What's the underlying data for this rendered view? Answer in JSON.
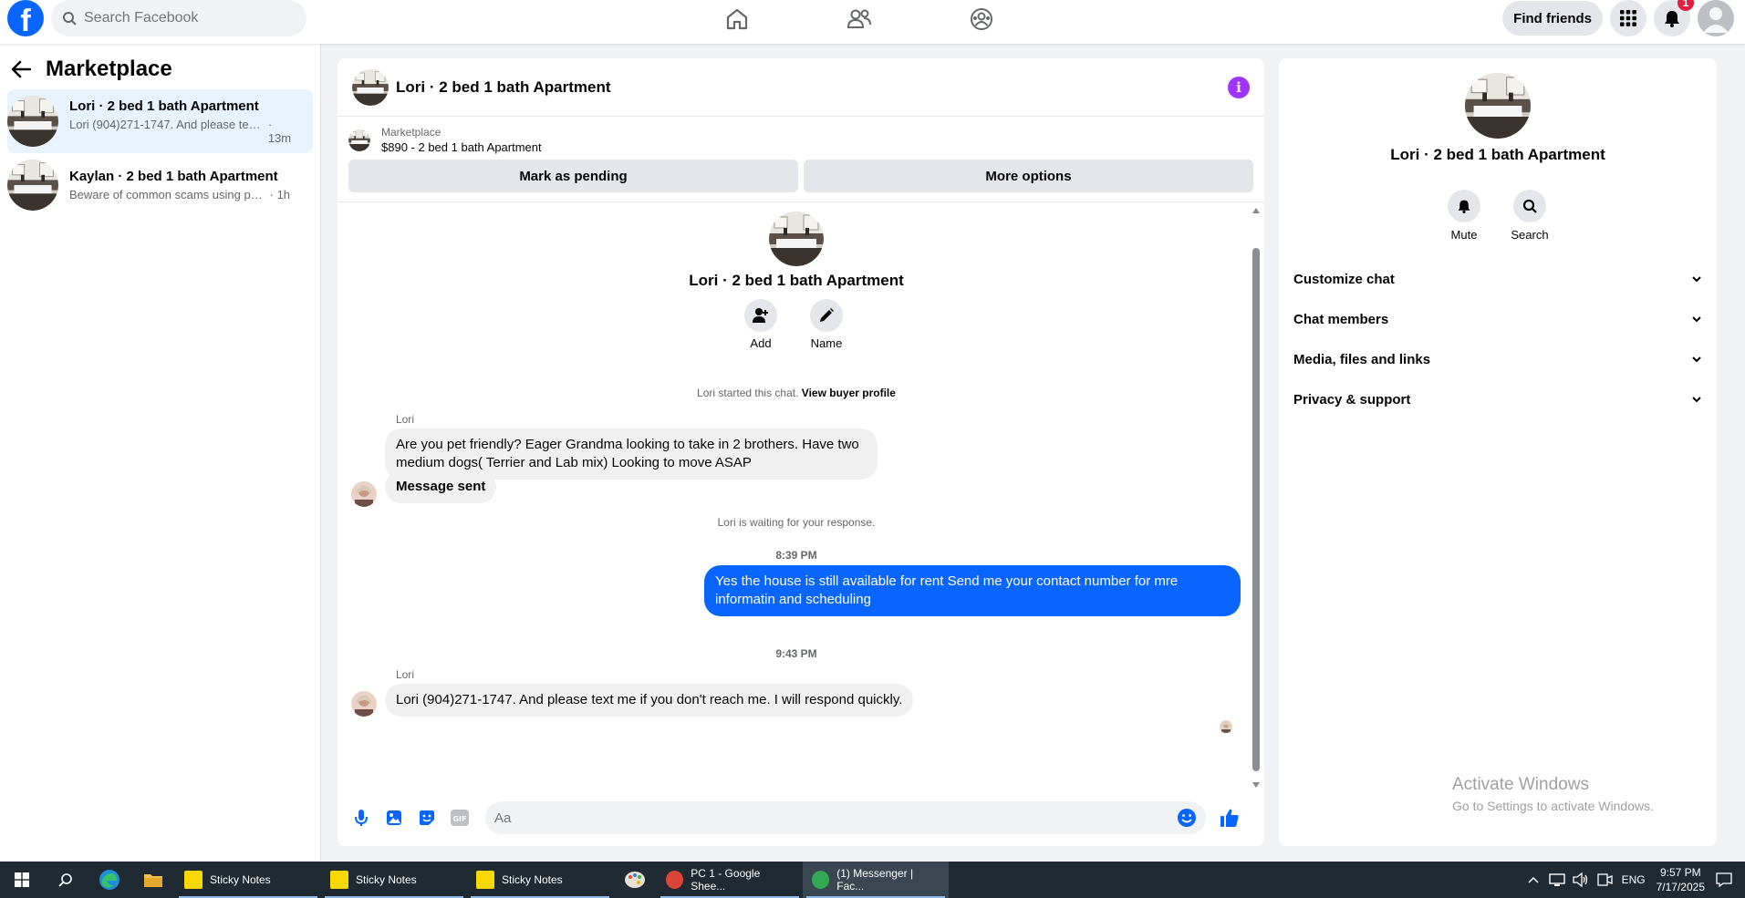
{
  "topbar": {
    "logo": "f",
    "search_placeholder": "Search Facebook",
    "find_friends": "Find friends",
    "notification_count": "1"
  },
  "sidebar": {
    "title": "Marketplace",
    "conversations": [
      {
        "title": "Lori · 2 bed 1 bath Apartment",
        "snippet": "Lori (904)271-1747. And please text ...",
        "time": "· 13m",
        "active": true
      },
      {
        "title": "Kaylan · 2 bed 1 bath Apartment",
        "snippet": "Beware of common scams using pay...",
        "time": "· 1h",
        "active": false
      }
    ]
  },
  "chat": {
    "header_title": "Lori · 2 bed 1 bath Apartment",
    "listing": {
      "source": "Marketplace",
      "price_title": "$890 - 2 bed 1 bath Apartment",
      "mark_pending": "Mark as pending",
      "more_options": "More options"
    },
    "intro": {
      "name": "Lori · 2 bed 1 bath Apartment",
      "add_label": "Add",
      "name_label": "Name",
      "started_text": "Lori started this chat.",
      "view_profile": "View buyer profile"
    },
    "messages": {
      "sender1": "Lori",
      "msg1": "Are you pet friendly? Eager Grandma looking to take in 2 brothers. Have two medium dogs( Terrier and Lab mix) Looking to move ASAP",
      "msg2": "Message sent",
      "waiting": "Lori is waiting for your response.",
      "time1": "8:39 PM",
      "msg3": "Yes the house is still available for rent Send me your contact number for mre informatin and  scheduling",
      "time2": "9:43 PM",
      "sender2": "Lori",
      "msg4": "Lori (904)271-1747. And please text me if you don't reach me. I will respond quickly."
    },
    "composer_placeholder": "Aa"
  },
  "rpanel": {
    "name": "Lori · 2 bed 1 bath Apartment",
    "mute": "Mute",
    "search": "Search",
    "sections": [
      "Customize chat",
      "Chat members",
      "Media, files and links",
      "Privacy & support"
    ]
  },
  "watermark": {
    "line1": "Activate Windows",
    "line2": "Go to Settings to activate Windows."
  },
  "taskbar": {
    "apps": [
      "Sticky Notes",
      "Sticky Notes",
      "Sticky Notes",
      "PC 1 - Google Shee...",
      "(1) Messenger | Fac..."
    ],
    "lang": "ENG",
    "time": "9:57 PM",
    "date": "7/17/2025"
  },
  "colors": {
    "brand": "#0866ff",
    "outgoing_bubble": "#0866ff",
    "info": "#a033ff",
    "badge": "#e41e3f"
  }
}
